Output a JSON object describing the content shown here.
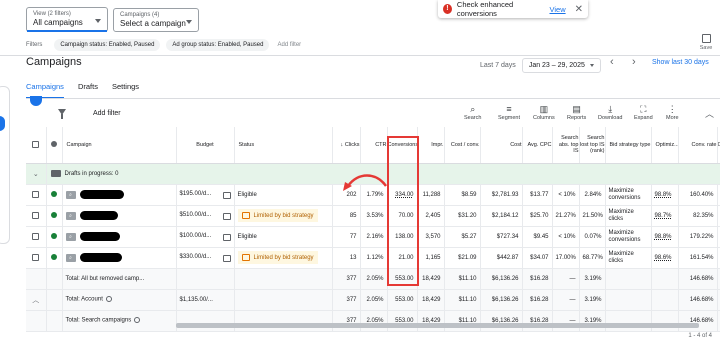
{
  "filters": {
    "view_small": "View (2 filters)",
    "view_main": "All campaigns",
    "campaigns_small": "Campaigns (4)",
    "campaigns_main": "Select a campaign",
    "label": "Filters",
    "chips": [
      "Campaign status: Enabled, Paused",
      "Ad group status: Enabled, Paused"
    ],
    "add_filter": "Add filter"
  },
  "toast": {
    "message": "Check enhanced conversions",
    "link": "View"
  },
  "save_label": "Save",
  "page_title": "Campaigns",
  "date": {
    "preset": "Last 7 days",
    "range": "Jan 23 – 29, 2025",
    "show_last": "Show last 30 days"
  },
  "tabs": [
    "Campaigns",
    "Drafts",
    "Settings"
  ],
  "toolbar": {
    "add_filter": "Add filter",
    "tools": [
      "Search",
      "Segment",
      "Columns",
      "Reports",
      "Download",
      "Expand",
      "More"
    ]
  },
  "columns": [
    "Campaign",
    "Budget",
    "Status",
    "Clicks",
    "CTR",
    "Conversions",
    "Impr.",
    "Cost / conv.",
    "Cost",
    "Avg. CPC",
    "Search abs. top IS",
    "Search lost top IS (rank)",
    "Bid strategy type",
    "Optimiz...",
    "Conv. rate",
    "C..."
  ],
  "drafts_label": "Drafts in progress: 0",
  "rows": [
    {
      "budget": "$195.00/d...",
      "status": "Eligible",
      "limited": false,
      "clicks": "202",
      "ctr": "1.79%",
      "conv": "334.00",
      "impr": "11,288",
      "cost_conv": "$8.59",
      "cost": "$2,781.93",
      "cpc": "$13.77",
      "abs_top": "< 10%",
      "lost_top": "2.84%",
      "bid": "Maximize conversions",
      "opt": "98.8%",
      "conv_rate": "160.40%",
      "c": "S"
    },
    {
      "budget": "$510.00/d...",
      "status": "Limited by bid strategy",
      "limited": true,
      "clicks": "85",
      "ctr": "3.53%",
      "conv": "70.00",
      "impr": "2,405",
      "cost_conv": "$31.20",
      "cost": "$2,184.12",
      "cpc": "$25.70",
      "abs_top": "21.27%",
      "lost_top": "21.50%",
      "bid": "Maximize clicks",
      "opt": "98.7%",
      "conv_rate": "82.35%",
      "c": "S"
    },
    {
      "budget": "$100.00/d...",
      "status": "Eligible",
      "limited": false,
      "clicks": "77",
      "ctr": "2.16%",
      "conv": "138.00",
      "impr": "3,570",
      "cost_conv": "$5.27",
      "cost": "$727.34",
      "cpc": "$9.45",
      "abs_top": "< 10%",
      "lost_top": "0.07%",
      "bid": "Maximize conversions",
      "opt": "98.8%",
      "conv_rate": "179.22%",
      "c": "S"
    },
    {
      "budget": "$330.00/d...",
      "status": "Limited by bid strategy",
      "limited": true,
      "clicks": "13",
      "ctr": "1.12%",
      "conv": "21.00",
      "impr": "1,165",
      "cost_conv": "$21.09",
      "cost": "$442.87",
      "cpc": "$34.07",
      "abs_top": "17.00%",
      "lost_top": "68.77%",
      "bid": "Maximize clicks",
      "opt": "98.6%",
      "conv_rate": "161.54%",
      "c": "S"
    }
  ],
  "totals": [
    {
      "label": "Total: All but removed camp...",
      "budget": "",
      "clicks": "377",
      "ctr": "2.05%",
      "conv": "553.00",
      "impr": "18,429",
      "cost_conv": "$11.10",
      "cost": "$6,136.26",
      "cpc": "$16.28",
      "abs_top": "—",
      "lost_top": "3.19%",
      "conv_rate": "146.68%"
    },
    {
      "label": "Total: Account",
      "budget": "$1,135.00/...",
      "clicks": "377",
      "ctr": "2.05%",
      "conv": "553.00",
      "impr": "18,429",
      "cost_conv": "$11.10",
      "cost": "$6,136.26",
      "cpc": "$16.28",
      "abs_top": "—",
      "lost_top": "3.19%",
      "conv_rate": "146.68%"
    },
    {
      "label": "Total: Search campaigns",
      "budget": "",
      "clicks": "377",
      "ctr": "2.05%",
      "conv": "553.00",
      "impr": "18,429",
      "cost_conv": "$11.10",
      "cost": "$6,136.26",
      "cpc": "$16.28",
      "abs_top": "—",
      "lost_top": "3.19%",
      "conv_rate": "146.68%"
    }
  ],
  "pager": "1 - 4 of 4"
}
